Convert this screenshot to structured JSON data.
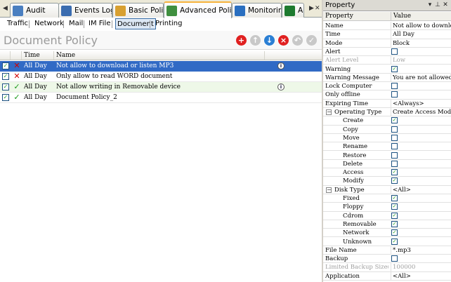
{
  "tabs": [
    {
      "label": "Audit",
      "icon": "audit-icon",
      "color": "#4a7fc0"
    },
    {
      "label": "Events Log",
      "icon": "events-log-icon",
      "color": "#3b6db0"
    },
    {
      "label": "Basic Policy",
      "icon": "basic-policy-icon",
      "color": "#d8a030"
    },
    {
      "label": "Advanced Policy",
      "icon": "advanced-policy-icon",
      "color": "#3f8f3f"
    },
    {
      "label": "Monitoring",
      "icon": "monitoring-icon",
      "color": "#2a6fc0"
    },
    {
      "label": "A...",
      "icon": "asset-icon",
      "color": "#1d7a2f"
    }
  ],
  "active_tab": "Advanced Policy",
  "subtabs": [
    "Traffic",
    "Network",
    "Mail",
    "IM File",
    "Document",
    "Printing"
  ],
  "active_subtab": "Document",
  "policy_title": "Document Policy",
  "toolbar": [
    {
      "name": "add-button",
      "glyph": "+",
      "color": "#e02020"
    },
    {
      "name": "move-up-button",
      "glyph": "↑",
      "color": "#c8c8c8"
    },
    {
      "name": "move-down-button",
      "glyph": "↓",
      "color": "#2a7fd4"
    },
    {
      "name": "delete-button",
      "glyph": "×",
      "color": "#e02020"
    },
    {
      "name": "undo-button",
      "glyph": "↶",
      "color": "#c8c8c8"
    },
    {
      "name": "apply-button",
      "glyph": "✓",
      "color": "#c8c8c8"
    }
  ],
  "grid": {
    "columns": [
      "Time",
      "Name"
    ],
    "rows": [
      {
        "checked": true,
        "action": "block",
        "time": "All Day",
        "name": "Not allow to download or listen MP3",
        "info": true,
        "selected": true
      },
      {
        "checked": true,
        "action": "block",
        "time": "All Day",
        "name": "Only allow to read WORD document",
        "info": false,
        "selected": false
      },
      {
        "checked": true,
        "action": "allow",
        "time": "All Day",
        "name": "Not allow writing in Removable device",
        "info": true,
        "selected": false
      },
      {
        "checked": true,
        "action": "allow",
        "time": "All Day",
        "name": "Document Policy_2",
        "info": false,
        "selected": false
      }
    ]
  },
  "property_panel": {
    "title": "Property",
    "columns": [
      "Property",
      "Value"
    ],
    "rows": [
      {
        "key": "Name",
        "type": "text",
        "value": "Not allow to downloa..."
      },
      {
        "key": "Time",
        "type": "text",
        "value": "All Day"
      },
      {
        "key": "Mode",
        "type": "text",
        "value": "Block"
      },
      {
        "key": "Alert",
        "type": "check",
        "checked": false
      },
      {
        "key": "Alert Level",
        "type": "text",
        "value": "Low",
        "disabled": true
      },
      {
        "key": "Warning",
        "type": "check",
        "checked": true
      },
      {
        "key": "Warning Message",
        "type": "text",
        "value": "You are not allowed t..."
      },
      {
        "key": "Lock Computer",
        "type": "check",
        "checked": false
      },
      {
        "key": "Only offline",
        "type": "check",
        "checked": false
      },
      {
        "key": "Expiring Time",
        "type": "text",
        "value": "<Always>"
      },
      {
        "key": "Operating Type",
        "type": "group",
        "value": "Create Access Modify"
      },
      {
        "key": "Create",
        "type": "check",
        "checked": true,
        "child": true
      },
      {
        "key": "Copy",
        "type": "check",
        "checked": false,
        "child": true
      },
      {
        "key": "Move",
        "type": "check",
        "checked": false,
        "child": true
      },
      {
        "key": "Rename",
        "type": "check",
        "checked": false,
        "child": true
      },
      {
        "key": "Restore",
        "type": "check",
        "checked": false,
        "child": true
      },
      {
        "key": "Delete",
        "type": "check",
        "checked": false,
        "child": true
      },
      {
        "key": "Access",
        "type": "check",
        "checked": true,
        "child": true
      },
      {
        "key": "Modify",
        "type": "check",
        "checked": true,
        "child": true
      },
      {
        "key": "Disk Type",
        "type": "group",
        "value": "<All>"
      },
      {
        "key": "Fixed",
        "type": "check",
        "checked": true,
        "child": true
      },
      {
        "key": "Floppy",
        "type": "check",
        "checked": true,
        "child": true
      },
      {
        "key": "Cdrom",
        "type": "check",
        "checked": true,
        "child": true
      },
      {
        "key": "Removable",
        "type": "check",
        "checked": true,
        "child": true
      },
      {
        "key": "Network",
        "type": "check",
        "checked": true,
        "child": true
      },
      {
        "key": "Unknown",
        "type": "check",
        "checked": true,
        "child": true
      },
      {
        "key": "File Name",
        "type": "text",
        "value": "*.mp3"
      },
      {
        "key": "Backup",
        "type": "check",
        "checked": false
      },
      {
        "key": "Limited Backup Size(...",
        "type": "text",
        "value": "100000",
        "disabled": true
      },
      {
        "key": "Application",
        "type": "text",
        "value": "<All>"
      }
    ]
  }
}
